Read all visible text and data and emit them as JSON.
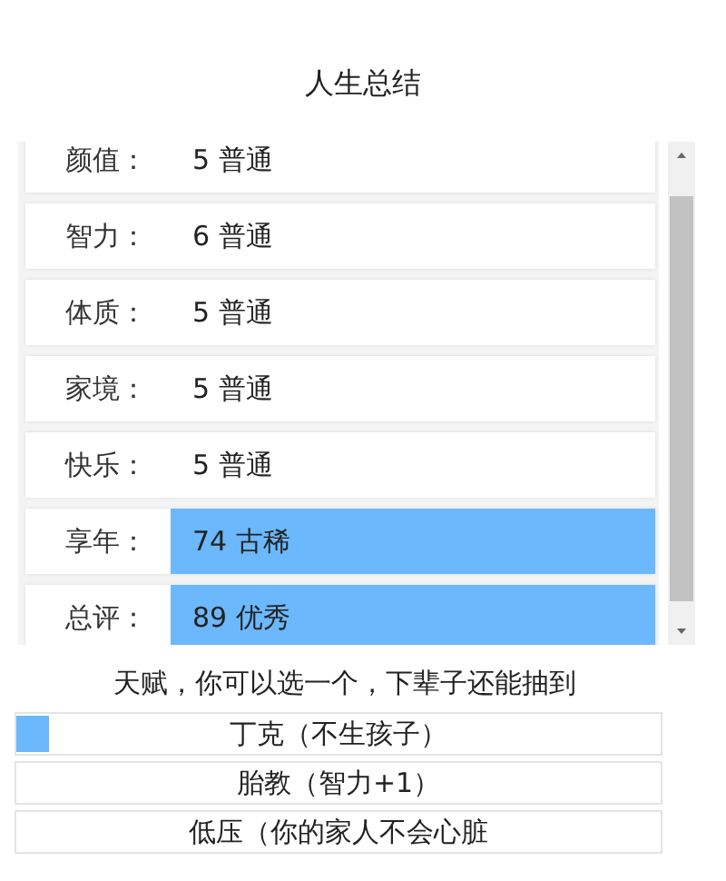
{
  "title": "人生总结",
  "stats": [
    {
      "label": "颜值：",
      "value": "5 普通",
      "highlighted": false
    },
    {
      "label": "智力：",
      "value": "6 普通",
      "highlighted": false
    },
    {
      "label": "体质：",
      "value": "5 普通",
      "highlighted": false
    },
    {
      "label": "家境：",
      "value": "5 普通",
      "highlighted": false
    },
    {
      "label": "快乐：",
      "value": "5 普通",
      "highlighted": false
    },
    {
      "label": "享年：",
      "value": "74 古稀",
      "highlighted": true
    },
    {
      "label": "总评：",
      "value": "89 优秀",
      "highlighted": true
    }
  ],
  "talent_heading": "天赋，你可以选一个，下辈子还能抽到",
  "talents": [
    {
      "label": "丁克（不生孩子）",
      "selected": true
    },
    {
      "label": "胎教（智力+1）",
      "selected": false
    },
    {
      "label": "低压（你的家人不会心脏",
      "selected": false
    }
  ]
}
